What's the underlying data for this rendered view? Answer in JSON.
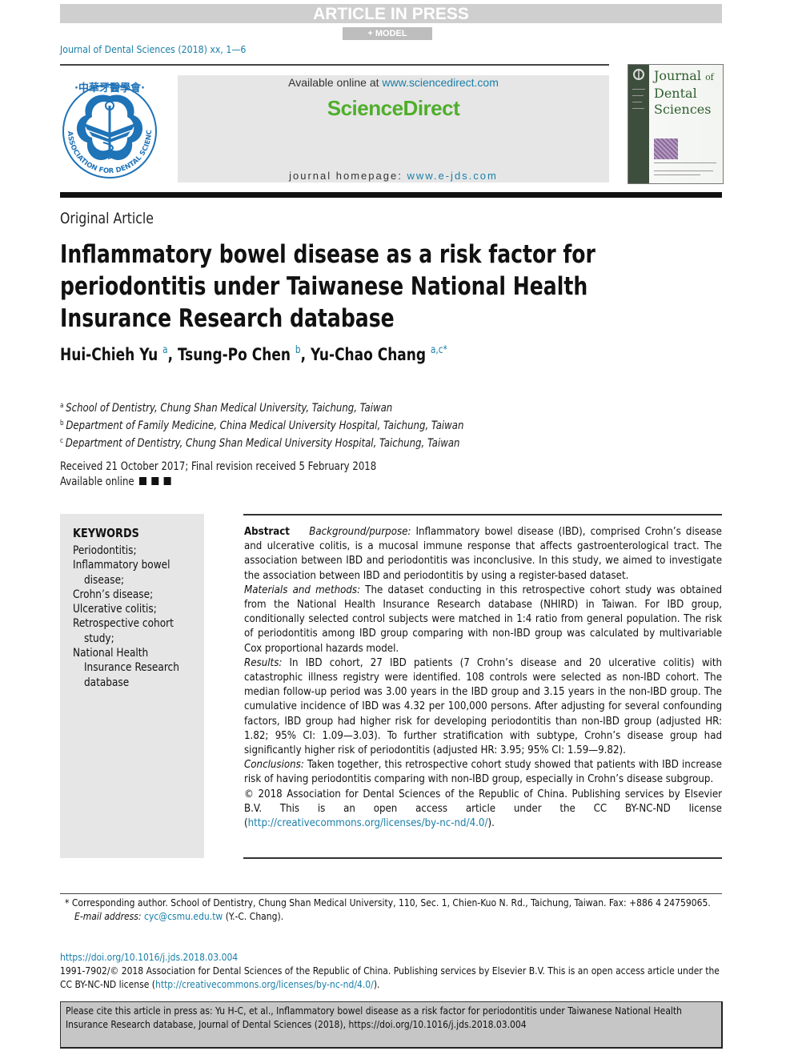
{
  "banner": {
    "status": "ARTICLE IN PRESS",
    "model_tag": "+ MODEL"
  },
  "journal_ref": "Journal of Dental Sciences (2018) xx, 1—6",
  "masthead": {
    "available_prefix": "Available online at ",
    "available_link": "www.sciencedirect.com",
    "platform_logo": "ScienceDirect",
    "homepage_prefix": "journal homepage: ",
    "homepage_link": "www.e-jds.com",
    "society_logo_text": "ASSOCIATION FOR DENTAL SCIENCES OF THE REPUBLIC OF CHINA",
    "cover": {
      "title_line1": "Journal",
      "title_of": "of",
      "title_line2": "Dental",
      "title_line3": "Sciences"
    },
    "colors": {
      "link": "#1a7fa8",
      "sciencedirect_green": "#4fae2c",
      "logo_blue": "#1f73b7",
      "cover_green": "#2f5e2f"
    }
  },
  "article": {
    "type": "Original Article",
    "title": "Inflammatory bowel disease as a risk factor for periodontitis under Taiwanese National Health Insurance Research database",
    "authors": [
      {
        "name": "Hui-Chieh Yu",
        "aff": "a"
      },
      {
        "name": "Tsung-Po Chen",
        "aff": "b"
      },
      {
        "name": "Yu-Chao Chang",
        "aff": "a,c*"
      }
    ],
    "affiliations": [
      {
        "mark": "a",
        "text": "School of Dentistry, Chung Shan Medical University, Taichung, Taiwan"
      },
      {
        "mark": "b",
        "text": "Department of Family Medicine, China Medical University Hospital, Taichung, Taiwan"
      },
      {
        "mark": "c",
        "text": "Department of Dentistry, Chung Shan Medical University Hospital, Taichung, Taiwan"
      }
    ],
    "received": "Received 21 October 2017; Final revision received 5 February 2018",
    "available_online": "Available online"
  },
  "keywords": {
    "heading": "KEYWORDS",
    "items": [
      "Periodontitis;",
      "Inflammatory bowel disease;",
      "Crohn’s disease;",
      "Ulcerative colitis;",
      "Retrospective cohort study;",
      "National Health Insurance Research database"
    ]
  },
  "abstract": {
    "label": "Abstract",
    "sections": [
      {
        "heading": "Background/purpose:",
        "text": " Inflammatory bowel disease (IBD), comprised Crohn’s disease and ulcerative colitis, is a mucosal immune response that affects gastroenterological tract. The association between IBD and periodontitis was inconclusive. In this study, we aimed to investigate the association between IBD and periodontitis by using a register-based dataset."
      },
      {
        "heading": "Materials and methods:",
        "text": " The dataset conducting in this retrospective cohort study was obtained from the National Health Insurance Research database (NHIRD) in Taiwan. For IBD group, conditionally selected control subjects were matched in 1:4 ratio from general population. The risk of periodontitis among IBD group comparing with non-IBD group was calculated by multivariable Cox proportional hazards model."
      },
      {
        "heading": "Results:",
        "text": " In IBD cohort, 27 IBD patients (7 Crohn’s disease and 20 ulcerative colitis) with catastrophic illness registry were identified. 108 controls were selected as non-IBD cohort. The median follow-up period was 3.00 years in the IBD group and 3.15 years in the non-IBD group. The cumulative incidence of IBD was 4.32 per 100,000 persons. After adjusting for several confounding factors, IBD group had higher risk for developing periodontitis than non-IBD group (adjusted HR: 1.82; 95% CI: 1.09—3.03). To further stratification with subtype, Crohn’s disease group had significantly higher risk of periodontitis (adjusted HR: 3.95; 95% CI: 1.59—9.82)."
      },
      {
        "heading": "Conclusions:",
        "text": " Taken together, this retrospective cohort study showed that patients with IBD increase risk of having periodontitis comparing with non-IBD group, especially in Crohn’s disease subgroup."
      }
    ],
    "copyright": "© 2018 Association for Dental Sciences of the Republic of China. Publishing services by Elsevier B.V. This is an open access article under the CC BY-NC-ND license (",
    "license_link": "http://creativecommons.org/licenses/by-nc-nd/4.0/",
    "copyright_end": ")."
  },
  "footnotes": {
    "corresponding": "* Corresponding author. School of Dentistry, Chung Shan Medical University, 110, Sec. 1, Chien-Kuo N. Rd., Taichung, Taiwan. Fax: +886 4 24759065.",
    "email_label": "E-mail address:",
    "email": "cyc@csmu.edu.tw",
    "email_suffix": " (Y.-C. Chang)."
  },
  "doi_block": {
    "doi": "https://doi.org/10.1016/j.jds.2018.03.004",
    "issn_copyright": "1991-7902/© 2018 Association for Dental Sciences of the Republic of China. Publishing services by Elsevier B.V. This is an open access article under the CC BY-NC-ND license (",
    "license_link": "http://creativecommons.org/licenses/by-nc-nd/4.0/",
    "end": ")."
  },
  "citation": {
    "text": "Please cite this article in press as: Yu H-C, et al., Inflammatory bowel disease as a risk factor for periodontitis under Taiwanese National Health Insurance Research database, Journal of Dental Sciences (2018), https://doi.org/10.1016/j.jds.2018.03.004"
  }
}
